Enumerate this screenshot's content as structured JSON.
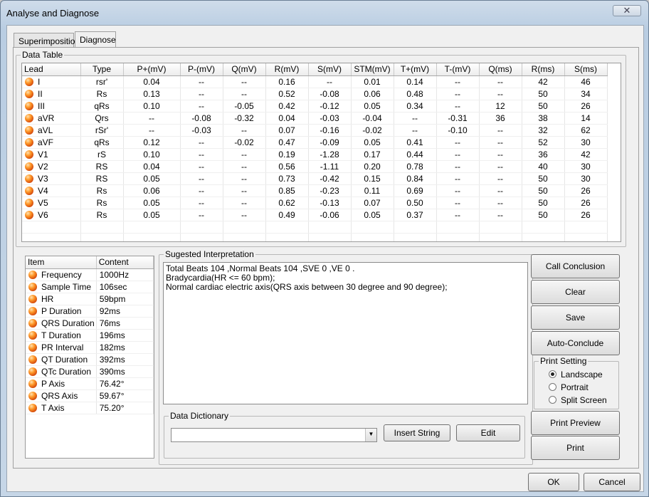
{
  "window": {
    "title": "Analyse and Diagnose",
    "close_glyph": "✕"
  },
  "tabs": [
    {
      "label": "Superimposition"
    },
    {
      "label": "Diagnose"
    }
  ],
  "data_table": {
    "title": "Data Table",
    "columns": [
      "Lead",
      "Type",
      "P+(mV)",
      "P-(mV)",
      "Q(mV)",
      "R(mV)",
      "S(mV)",
      "STM(mV)",
      "T+(mV)",
      "T-(mV)",
      "Q(ms)",
      "R(ms)",
      "S(ms)"
    ],
    "rows": [
      [
        "I",
        "rsr'",
        "0.04",
        "--",
        "--",
        "0.16",
        "--",
        "0.01",
        "0.14",
        "--",
        "--",
        "42",
        "46"
      ],
      [
        "II",
        "Rs",
        "0.13",
        "--",
        "--",
        "0.52",
        "-0.08",
        "0.06",
        "0.48",
        "--",
        "--",
        "50",
        "34"
      ],
      [
        "III",
        "qRs",
        "0.10",
        "--",
        "-0.05",
        "0.42",
        "-0.12",
        "0.05",
        "0.34",
        "--",
        "12",
        "50",
        "26"
      ],
      [
        "aVR",
        "Qrs",
        "--",
        "-0.08",
        "-0.32",
        "0.04",
        "-0.03",
        "-0.04",
        "--",
        "-0.31",
        "36",
        "38",
        "14"
      ],
      [
        "aVL",
        "rSr'",
        "--",
        "-0.03",
        "--",
        "0.07",
        "-0.16",
        "-0.02",
        "--",
        "-0.10",
        "--",
        "32",
        "62"
      ],
      [
        "aVF",
        "qRs",
        "0.12",
        "--",
        "-0.02",
        "0.47",
        "-0.09",
        "0.05",
        "0.41",
        "--",
        "--",
        "52",
        "30"
      ],
      [
        "V1",
        "rS",
        "0.10",
        "--",
        "--",
        "0.19",
        "-1.28",
        "0.17",
        "0.44",
        "--",
        "--",
        "36",
        "42"
      ],
      [
        "V2",
        "RS",
        "0.04",
        "--",
        "--",
        "0.56",
        "-1.11",
        "0.20",
        "0.78",
        "--",
        "--",
        "40",
        "30"
      ],
      [
        "V3",
        "RS",
        "0.05",
        "--",
        "--",
        "0.73",
        "-0.42",
        "0.15",
        "0.84",
        "--",
        "--",
        "50",
        "30"
      ],
      [
        "V4",
        "Rs",
        "0.06",
        "--",
        "--",
        "0.85",
        "-0.23",
        "0.11",
        "0.69",
        "--",
        "--",
        "50",
        "26"
      ],
      [
        "V5",
        "Rs",
        "0.05",
        "--",
        "--",
        "0.62",
        "-0.13",
        "0.07",
        "0.50",
        "--",
        "--",
        "50",
        "26"
      ],
      [
        "V6",
        "Rs",
        "0.05",
        "--",
        "--",
        "0.49",
        "-0.06",
        "0.05",
        "0.37",
        "--",
        "--",
        "50",
        "26"
      ]
    ]
  },
  "measurements": {
    "columns": [
      "Item",
      "Content"
    ],
    "rows": [
      [
        "Frequency",
        "1000Hz"
      ],
      [
        "Sample Time",
        "106sec"
      ],
      [
        "HR",
        "59bpm"
      ],
      [
        "P Duration",
        "92ms"
      ],
      [
        "QRS Duration",
        "76ms"
      ],
      [
        "T Duration",
        "196ms"
      ],
      [
        "PR Interval",
        "182ms"
      ],
      [
        "QT Duration",
        "392ms"
      ],
      [
        "QTc Duration",
        "390ms"
      ],
      [
        "P Axis",
        "76.42°"
      ],
      [
        "QRS Axis",
        "59.67°"
      ],
      [
        "T Axis",
        "75.20°"
      ]
    ]
  },
  "interpretation": {
    "title": "Sugested Interpretation",
    "lines": [
      "Total Beats 104 ,Normal Beats 104 ,SVE 0 ,VE  0 .",
      "Bradycardia(HR <= 60 bpm);",
      "Normal cardiac electric axis(QRS axis between 30 degree and 90 degree);"
    ]
  },
  "data_dictionary": {
    "title": "Data Dictionary",
    "selected": "",
    "insert_label": "Insert String",
    "edit_label": "Edit"
  },
  "actions": {
    "call_conclusion": "Call Conclusion",
    "clear": "Clear",
    "save": "Save",
    "auto_conclude": "Auto-Conclude",
    "print_preview": "Print Preview",
    "print": "Print"
  },
  "print_setting": {
    "title": "Print Setting",
    "options": [
      "Landscape",
      "Portrait",
      "Split Screen"
    ],
    "selected": "Landscape"
  },
  "footer": {
    "ok": "OK",
    "cancel": "Cancel"
  }
}
